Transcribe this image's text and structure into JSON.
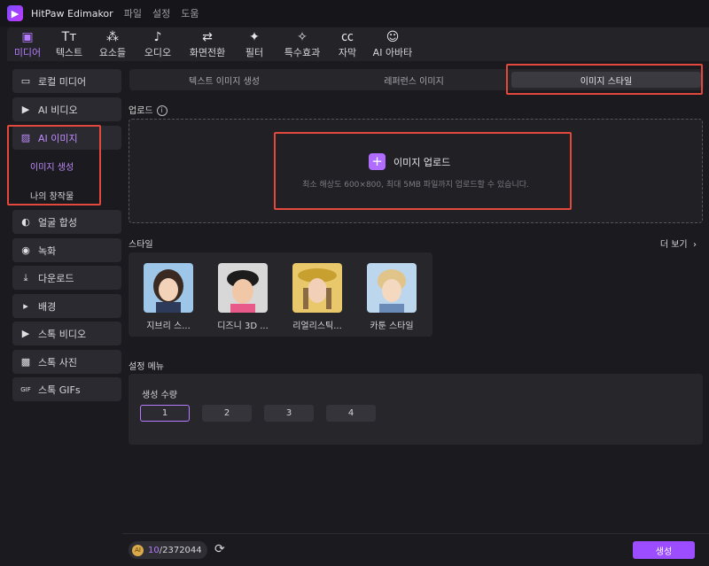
{
  "app": {
    "title": "HitPaw Edimakor",
    "menu": [
      "파일",
      "설정",
      "도움"
    ]
  },
  "toolbar": {
    "tools": [
      {
        "label": "미디어",
        "icon": "media-icon",
        "active": true
      },
      {
        "label": "텍스트",
        "icon": "text-icon"
      },
      {
        "label": "요소들",
        "icon": "elements-icon"
      },
      {
        "label": "오디오",
        "icon": "audio-icon"
      },
      {
        "label": "화면전환",
        "icon": "transition-icon"
      },
      {
        "label": "필터",
        "icon": "filter-icon"
      },
      {
        "label": "특수효과",
        "icon": "effects-icon"
      },
      {
        "label": "자막",
        "icon": "subtitle-icon"
      },
      {
        "label": "AI 아바타",
        "icon": "avatar-icon"
      }
    ]
  },
  "sidebar": {
    "items": [
      {
        "label": "로컬 미디어",
        "icon": "folder-icon"
      },
      {
        "label": "AI 비디오",
        "icon": "ai-video-icon"
      },
      {
        "label": "AI 이미지",
        "icon": "ai-image-icon",
        "active": true
      },
      {
        "label": "얼굴 합성",
        "icon": "face-swap-icon"
      },
      {
        "label": "녹화",
        "icon": "record-icon"
      },
      {
        "label": "다운로드",
        "icon": "download-icon"
      },
      {
        "label": "배경",
        "icon": "background-icon"
      },
      {
        "label": "스톡 비디오",
        "icon": "stock-video-icon"
      },
      {
        "label": "스톡 사진",
        "icon": "stock-photo-icon"
      },
      {
        "label": "스톡 GIFs",
        "icon": "gif-icon"
      }
    ],
    "sub_items": [
      {
        "label": "이미지 생성",
        "active": true
      },
      {
        "label": "나의 창작물"
      }
    ]
  },
  "tabs": [
    {
      "label": "텍스트 이미지 생성"
    },
    {
      "label": "레퍼런스 이미지"
    },
    {
      "label": "이미지 스타일",
      "active": true
    }
  ],
  "upload": {
    "section_label": "업로드",
    "button_label": "이미지 업로드",
    "hint": "최소 해상도 600×800, 최대 5MB 파일까지 업로드할 수 있습니다."
  },
  "styles": {
    "section_label": "스타일",
    "more_label": "더 보기",
    "items": [
      {
        "name": "지브리 스...",
        "colors": [
          "#9ec6e8",
          "#3a2a22",
          "#f2d2b8",
          "#2d3a5a"
        ]
      },
      {
        "name": "디즈니 3D ...",
        "colors": [
          "#d8d8d8",
          "#1c1c1c",
          "#f0c8a8",
          "#e85a8a"
        ]
      },
      {
        "name": "리얼리스틱...",
        "colors": [
          "#e8c86a",
          "#c8a030",
          "#f2d0b8",
          "#8a6a40"
        ]
      },
      {
        "name": "카툰 스타일",
        "colors": [
          "#bcd6ee",
          "#e0c48a",
          "#f4d8c0",
          "#6a8ab8"
        ]
      }
    ]
  },
  "settings": {
    "section_label": "설정 메뉴",
    "quantity_label": "생성 수량",
    "quantities": [
      "1",
      "2",
      "3",
      "4"
    ],
    "selected_quantity": "1"
  },
  "footer": {
    "credits_used": "10",
    "credits_total": "/2372044",
    "generate_label": "생성"
  },
  "colors": {
    "accent": "#b57cff",
    "highlight": "#e2483b",
    "generate": "#9b4dff"
  }
}
